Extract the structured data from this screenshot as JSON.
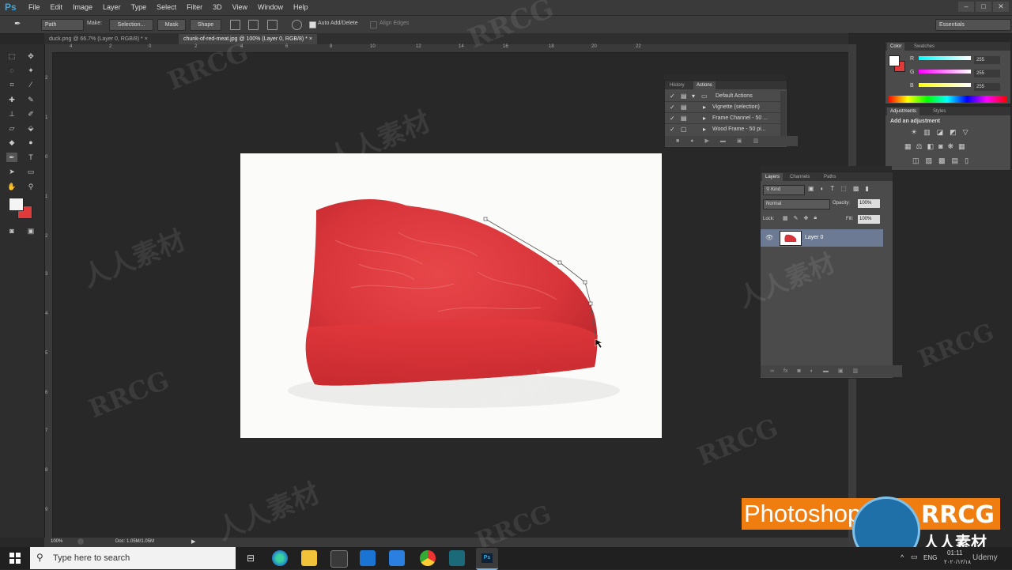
{
  "app": {
    "logo": "Ps"
  },
  "menu": [
    "File",
    "Edit",
    "Image",
    "Layer",
    "Type",
    "Select",
    "Filter",
    "3D",
    "View",
    "Window",
    "Help"
  ],
  "window_controls": [
    "–",
    "□",
    "✕"
  ],
  "options_bar": {
    "mode_select": "Path",
    "make_label": "Make:",
    "selection_btn": "Selection...",
    "mask_btn": "Mask",
    "shape_btn": "Shape",
    "auto_add_delete": "Auto Add/Delete",
    "align_edges": "Align Edges",
    "workspace": "Essentials"
  },
  "tabs": [
    {
      "label": "duck.png @ 66.7% (Layer 0, RGB/8) *",
      "close": "×"
    },
    {
      "label": "chunk-of-red-meat.jpg @ 100% (Layer 0, RGB/8) *",
      "close": "×"
    }
  ],
  "ruler_top": [
    "4",
    "2",
    "0",
    "2",
    "4",
    "6",
    "8",
    "10",
    "12",
    "14",
    "16",
    "18",
    "20",
    "22"
  ],
  "ruler_left": [
    "2",
    "1",
    "0",
    "1",
    "2",
    "3",
    "4",
    "5",
    "6",
    "7",
    "8",
    "9"
  ],
  "status": {
    "zoom": "100%",
    "doc": "Doc: 1.05M/1.05M"
  },
  "color_panel": {
    "tabs": [
      "Color",
      "Swatches"
    ],
    "r": {
      "label": "R",
      "value": "255"
    },
    "g": {
      "label": "G",
      "value": "255"
    },
    "b": {
      "label": "B",
      "value": "255"
    }
  },
  "adjustments": {
    "tabs": [
      "Adjustments",
      "Styles"
    ],
    "title": "Add an adjustment"
  },
  "history_actions": {
    "tabs": [
      "History",
      "Actions"
    ],
    "rows": [
      "Default Actions",
      "Vignette (selection)",
      "Frame Channel - 50 ...",
      "Wood Frame - 50 pi..."
    ]
  },
  "layers": {
    "tabs": [
      "Layers",
      "Channels",
      "Paths"
    ],
    "kind": "Kind",
    "blend": "Normal",
    "opacity_label": "Opacity:",
    "opacity": "100%",
    "lock_label": "Lock:",
    "fill_label": "Fill:",
    "fill": "100%",
    "layer_name": "Layer 0"
  },
  "watermark": {
    "brand": "RRCG",
    "cn": "人人素材"
  },
  "banner": "Photoshop Ess",
  "taskbar": {
    "search_placeholder": "Type here to search",
    "lang": "ENG",
    "time": "01:11",
    "date": "۲۰۲۰/۱۲/۱۸",
    "site": "Udemy"
  },
  "colors": {
    "accent": "#39a7e0",
    "bg_swatch": "#e03a3a",
    "meat": "#d8353a",
    "banner": "#f07d10"
  }
}
